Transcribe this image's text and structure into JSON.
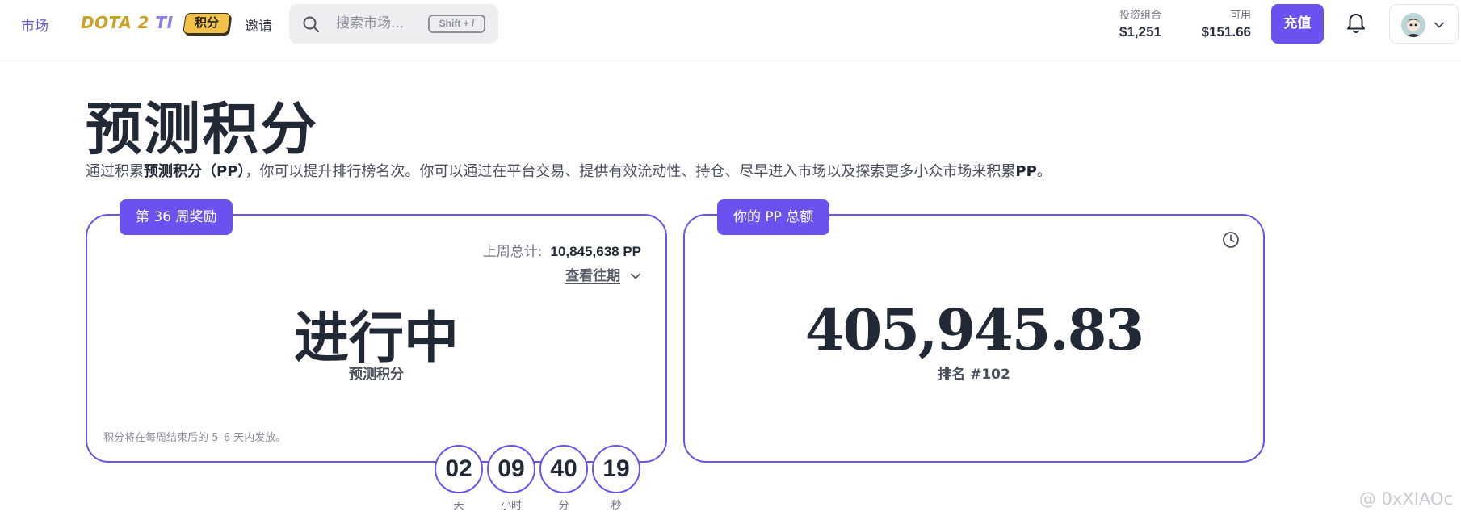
{
  "nav": {
    "market": "市场",
    "dota_part1": "DOTA 2",
    "dota_part2": "TI",
    "points": "积分",
    "invite": "邀请"
  },
  "search": {
    "placeholder": "搜索市场...",
    "shortcut": "Shift + /"
  },
  "account": {
    "portfolio_label": "投资组合",
    "portfolio_value": "$1,251",
    "available_label": "可用",
    "available_value": "$151.66",
    "deposit_label": "充值"
  },
  "page": {
    "title": "预测积分",
    "intro_pre": "通过积累",
    "intro_bold": "预测积分（PP）",
    "intro_mid": "，你可以提升排行榜名次。你可以通过在平台交易、提供有效流动性、持仓、尽早进入市场以及探索更多小众市场来积累",
    "intro_bold2": "PP",
    "intro_end": "。"
  },
  "week_card": {
    "tag": "第 36 周奖励",
    "last_week_label": "上周总计:",
    "last_week_value": "10,845,638 PP",
    "history_link": "查看往期",
    "status": "进行中",
    "status_sub": "预测积分",
    "note": "积分将在每周结束后的 5–6 天内发放。"
  },
  "total_card": {
    "tag": "你的 PP 总额",
    "total": "405,945.83",
    "rank": "排名 #102"
  },
  "countdown": {
    "days": "02",
    "hours": "09",
    "minutes": "40",
    "seconds": "19",
    "days_label": "天",
    "hours_label": "小时",
    "minutes_label": "分",
    "seconds_label": "秒"
  },
  "watermark": "@ 0xXIAOc",
  "icons": {
    "search": "search-icon",
    "bell": "bell-icon",
    "clock": "clock-icon",
    "chevron": "chevron-down-icon"
  },
  "colors": {
    "accent": "#6b52f0",
    "points_badge": "#f1c24a",
    "text_dark": "#222936"
  }
}
